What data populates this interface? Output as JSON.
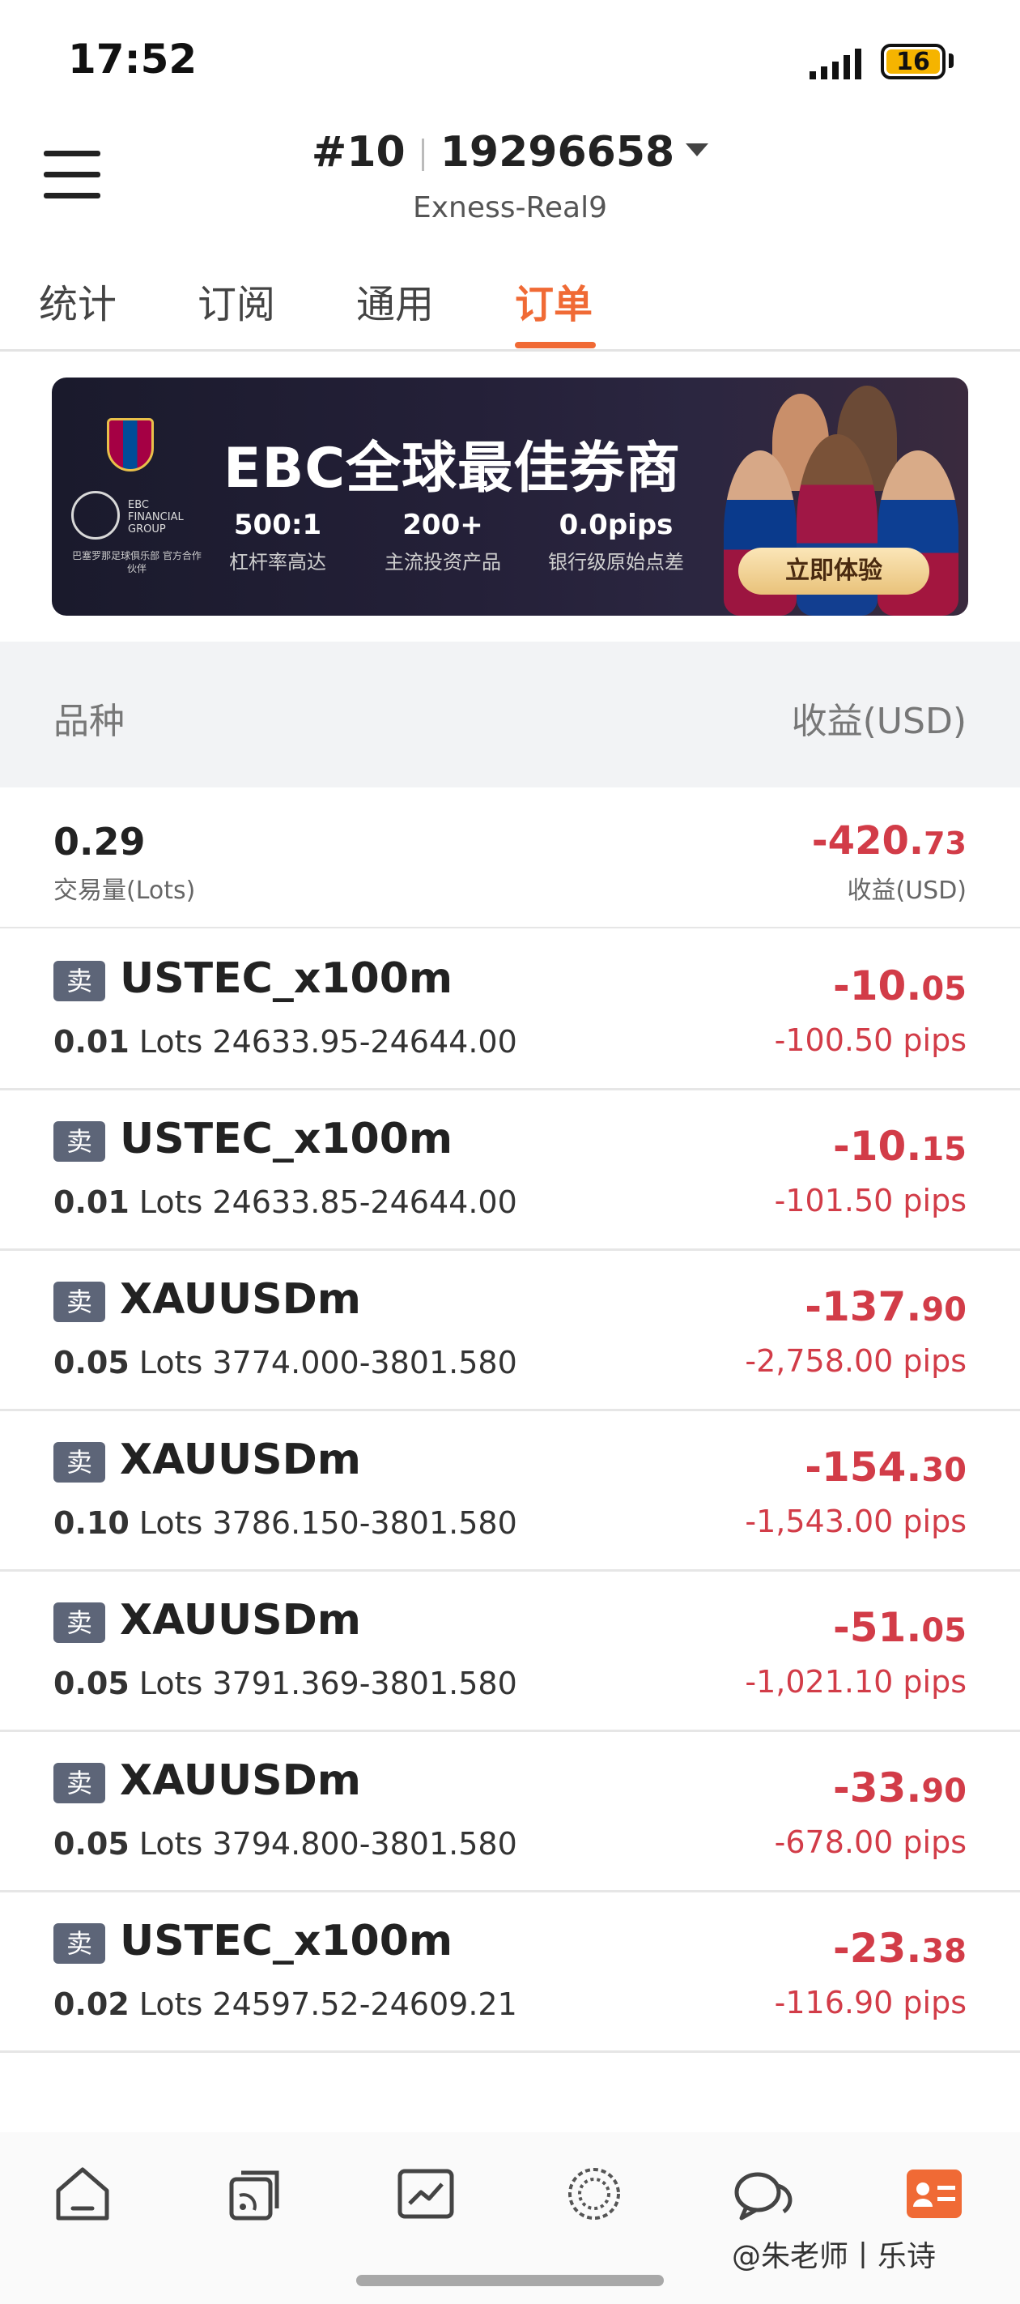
{
  "status_bar": {
    "time": "17:52",
    "battery": "16"
  },
  "header": {
    "account_id": "#10",
    "account_number": "19296658",
    "server": "Exness-Real9"
  },
  "tabs": [
    {
      "label": "统计",
      "active": false
    },
    {
      "label": "订阅",
      "active": false
    },
    {
      "label": "通用",
      "active": false
    },
    {
      "label": "订单",
      "active": true
    }
  ],
  "banner": {
    "title": "EBC全球最佳券商",
    "logo_text": "EBC FINANCIAL GROUP",
    "partner_text": "巴塞罗那足球俱乐部 官方合作伙伴",
    "stats": [
      {
        "value": "500:1",
        "label": "杠杆率高达"
      },
      {
        "value": "200+",
        "label": "主流投资产品"
      },
      {
        "value": "0.0pips",
        "label": "银行级原始点差"
      }
    ],
    "cta": "立即体验"
  },
  "table_header": {
    "left": "品种",
    "right": "收益(USD)"
  },
  "summary": {
    "lots": "0.29",
    "lots_label": "交易量(Lots)",
    "profit_main": "-420.",
    "profit_dec": "73",
    "profit_label": "收益(USD)"
  },
  "orders": [
    {
      "side": "卖",
      "symbol": "USTEC_x100m",
      "lots": "0.01",
      "lots_unit": "Lots",
      "prices": "24633.95-24644.00",
      "profit_main": "-10.",
      "profit_dec": "05",
      "pips": "-100.50 pips"
    },
    {
      "side": "卖",
      "symbol": "USTEC_x100m",
      "lots": "0.01",
      "lots_unit": "Lots",
      "prices": "24633.85-24644.00",
      "profit_main": "-10.",
      "profit_dec": "15",
      "pips": "-101.50 pips"
    },
    {
      "side": "卖",
      "symbol": "XAUUSDm",
      "lots": "0.05",
      "lots_unit": "Lots",
      "prices": "3774.000-3801.580",
      "profit_main": "-137.",
      "profit_dec": "90",
      "pips": "-2,758.00 pips"
    },
    {
      "side": "卖",
      "symbol": "XAUUSDm",
      "lots": "0.10",
      "lots_unit": "Lots",
      "prices": "3786.150-3801.580",
      "profit_main": "-154.",
      "profit_dec": "30",
      "pips": "-1,543.00 pips"
    },
    {
      "side": "卖",
      "symbol": "XAUUSDm",
      "lots": "0.05",
      "lots_unit": "Lots",
      "prices": "3791.369-3801.580",
      "profit_main": "-51.",
      "profit_dec": "05",
      "pips": "-1,021.10 pips"
    },
    {
      "side": "卖",
      "symbol": "XAUUSDm",
      "lots": "0.05",
      "lots_unit": "Lots",
      "prices": "3794.800-3801.580",
      "profit_main": "-33.",
      "profit_dec": "90",
      "pips": "-678.00 pips"
    },
    {
      "side": "卖",
      "symbol": "USTEC_x100m",
      "lots": "0.02",
      "lots_unit": "Lots",
      "prices": "24597.52-24609.21",
      "profit_main": "-23.",
      "profit_dec": "38",
      "pips": "-116.90 pips"
    }
  ],
  "bottom_nav": [
    {
      "icon": "home-icon"
    },
    {
      "icon": "signals-icon"
    },
    {
      "icon": "chart-icon"
    },
    {
      "icon": "community-icon"
    },
    {
      "icon": "chat-icon"
    },
    {
      "icon": "profile-card-icon"
    }
  ],
  "watermark": "@朱老师丨乐诗",
  "colors": {
    "accent": "#f06a35",
    "loss": "#d23c48",
    "badge": "#5d6578"
  }
}
